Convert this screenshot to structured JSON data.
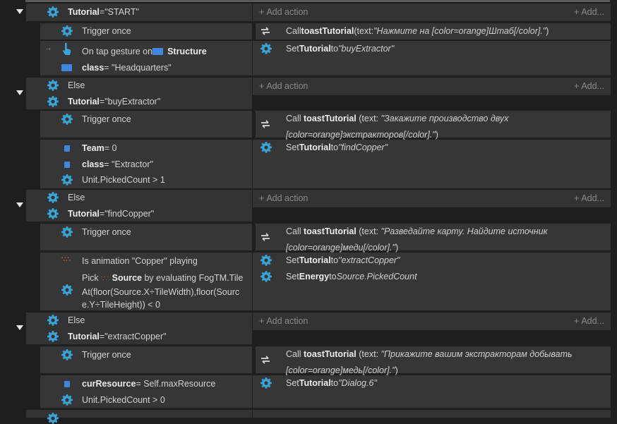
{
  "colors": {
    "accent_gear": "#3aa3d8",
    "object_blue": "#3f86e0",
    "background": "#1e1e1e"
  },
  "groups": [
    {
      "header": {
        "else_label": "",
        "var": "Tutorial",
        "op": " = ",
        "value": "\"START\""
      },
      "add_action": "Add action",
      "add_more": "Add...",
      "trigger": {
        "label": "Trigger once",
        "action": {
          "call": "Call ",
          "fn": "toastTutorial",
          "args_pre": " (text: ",
          "args": "\"Нажмите на [color=orange]Штаб[/color].\"",
          "args_post": ")"
        }
      },
      "conditions": [
        {
          "pre": "On tap gesture on ",
          "obj": "Structure"
        },
        {
          "obj": "class",
          "rest": " = \"Headquarters\""
        }
      ],
      "actions": [
        {
          "pre": "Set ",
          "var": "Tutorial",
          "mid": " to ",
          "value": "\"buyExtractor\""
        }
      ]
    },
    {
      "header": {
        "else_label": "Else",
        "var": "Tutorial",
        "op": " = ",
        "value": "\"buyExtractor\""
      },
      "add_action": "Add action",
      "add_more": "Add...",
      "trigger": {
        "label": "Trigger once",
        "action": {
          "call": "Call ",
          "fn": "toastTutorial",
          "args_pre": " (text: ",
          "args": "\"Закажите производство двух [color=orange]экстракторов[/color].\"",
          "args_post": ")"
        }
      },
      "conditions": [
        {
          "obj": "Team",
          "rest": " = 0"
        },
        {
          "obj": "class",
          "rest": " = \"Extractor\""
        },
        {
          "pre": "Unit.PickedCount > 1"
        }
      ],
      "actions": [
        {
          "pre": "Set ",
          "var": "Tutorial",
          "mid": " to ",
          "value": "\"findCopper\""
        }
      ]
    },
    {
      "header": {
        "else_label": "Else",
        "var": "Tutorial",
        "op": " = ",
        "value": "\"findCopper\""
      },
      "add_action": "Add action",
      "add_more": "Add...",
      "trigger": {
        "label": "Trigger once",
        "action": {
          "call": "Call ",
          "fn": "toastTutorial",
          "args_pre": " (text: ",
          "args": "\"Разведайте карту. Найдите источник [color=orange]меди[/color].\"",
          "args_post": ")"
        }
      },
      "conditions": [
        {
          "pre": "Is animation \"Copper\" playing"
        },
        {
          "pre": "Pick ",
          "obj": "Source",
          "rest": " by evaluating FogTM.TileAt(floor(Source.X÷TileWidth),floor(Source.Y÷TileHeight)) < 0"
        }
      ],
      "actions": [
        {
          "pre": "Set ",
          "var": "Tutorial",
          "mid": " to ",
          "value": "\"extractCopper\""
        },
        {
          "pre": "Set ",
          "var": "Energy",
          "mid": " to ",
          "value": "Source.PickedCount"
        }
      ]
    },
    {
      "header": {
        "else_label": "Else",
        "var": "Tutorial",
        "op": " = ",
        "value": "\"extractCopper\""
      },
      "add_action": "Add action",
      "add_more": "Add...",
      "trigger": {
        "label": "Trigger once",
        "action": {
          "call": "Call ",
          "fn": "toastTutorial",
          "args_pre": " (text: ",
          "args": "\"Прикажите вашим экстракторам добывать [color=orange]медь[/color].\"",
          "args_post": ")"
        }
      },
      "conditions": [
        {
          "obj": "curResource",
          "rest": " = Self.maxResource"
        },
        {
          "pre": "Unit.PickedCount > 0"
        }
      ],
      "actions": [
        {
          "pre": "Set ",
          "var": "Tutorial",
          "mid": " to ",
          "value": "\"Dialog.6\""
        }
      ]
    }
  ]
}
